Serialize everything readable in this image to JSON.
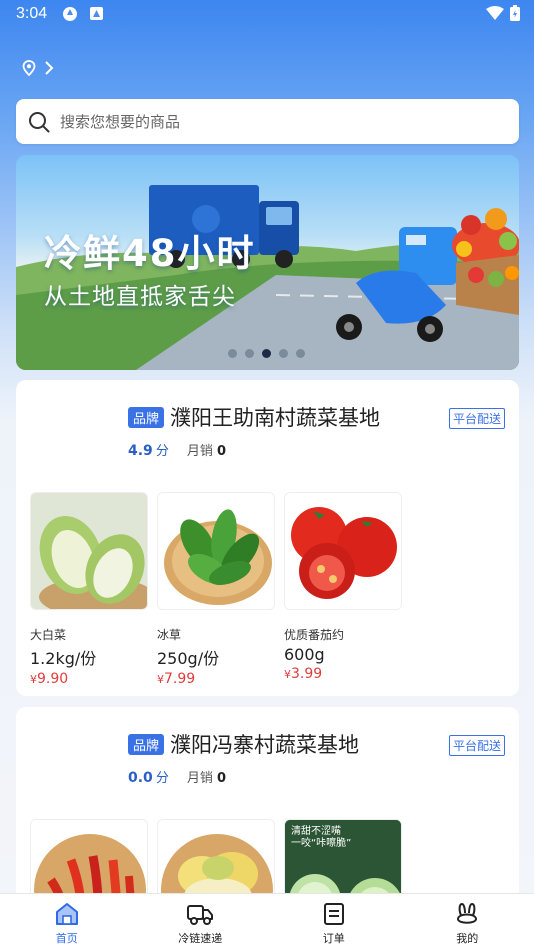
{
  "status_bar": {
    "time": "3:04"
  },
  "search": {
    "placeholder": "搜索您想要的商品"
  },
  "banner": {
    "title": "冷鲜48小时",
    "subtitle": "从土地直抵家舌尖",
    "dots": 5,
    "active_dot": 3
  },
  "stores": [
    {
      "badge": "品牌",
      "name": "濮阳王助南村蔬菜基地",
      "platform_tag": "平台配送",
      "rating": "4.9",
      "rating_unit": "分",
      "sales_label": "月销",
      "sales_count": "0",
      "products": [
        {
          "name": "大白菜",
          "spec": "1.2kg/份",
          "price_symbol": "¥",
          "price": "9.90",
          "image": "napa-cabbage"
        },
        {
          "name": "冰草",
          "spec": "250g/份",
          "price_symbol": "¥",
          "price": "7.99",
          "image": "ice-plant"
        },
        {
          "name": "优质番茄约",
          "spec": "600g",
          "price_symbol": "¥",
          "price": "3.99",
          "image": "tomatoes"
        }
      ]
    },
    {
      "badge": "品牌",
      "name": "濮阳冯寨村蔬菜基地",
      "platform_tag": "平台配送",
      "rating": "0.0",
      "rating_unit": "分",
      "sales_label": "月销",
      "sales_count": "0",
      "products": [
        {
          "image": "red-chili-peppers"
        },
        {
          "image": "napa-cabbage"
        },
        {
          "image": "cucumber",
          "overlay_line1": "清甜不涩嘴",
          "overlay_line2": "一咬“咔嚓脆”"
        }
      ]
    }
  ],
  "tabbar": {
    "items": [
      {
        "label": "首页",
        "icon": "home-icon"
      },
      {
        "label": "冷链速递",
        "icon": "delivery-truck-icon"
      },
      {
        "label": "订单",
        "icon": "order-list-icon"
      },
      {
        "label": "我的",
        "icon": "bunny-profile-icon"
      }
    ],
    "active_index": 0
  },
  "colors": {
    "accent": "#3a72e6",
    "price": "#e23b3b"
  }
}
